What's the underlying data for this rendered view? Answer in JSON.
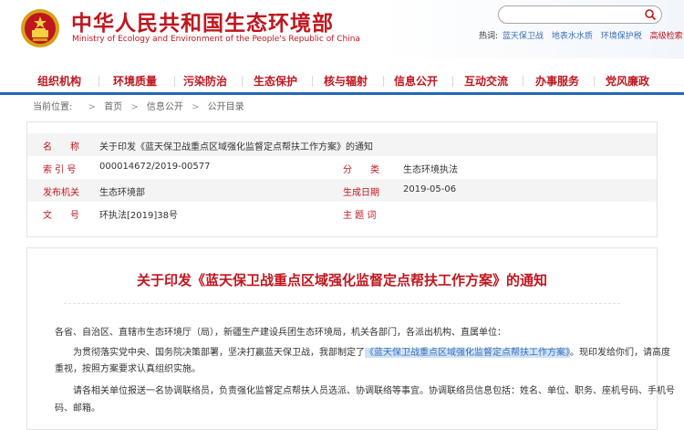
{
  "site": {
    "title_cn": "中华人民共和国生态环境部",
    "title_en": "Ministry of Ecology and Environment of the People's Republic of China",
    "brand_color": "#c0161e",
    "accent_color": "#2767b5"
  },
  "search": {
    "value": "",
    "placeholder": ""
  },
  "hot_search": {
    "label": "热词:",
    "terms": [
      "蓝天保卫战",
      "地表水水质",
      "环境保护税"
    ],
    "advanced": "高级检索"
  },
  "nav": {
    "items": [
      "组织机构",
      "环境质量",
      "污染防治",
      "生态保护",
      "核与辐射",
      "信息公开",
      "互动交流",
      "办事服务",
      "党风廉政"
    ]
  },
  "breadcrumb": {
    "label": "当前位置:",
    "items": [
      "首页",
      "信息公开",
      "公开目录"
    ]
  },
  "meta": {
    "name_label": "名　　称",
    "name_value": "关于印发《蓝天保卫战重点区域强化监督定点帮扶工作方案》的通知",
    "index_label": "索 引 号",
    "index_value": "000014672/2019-00577",
    "category_label": "分　　类",
    "category_value": "生态环境执法",
    "issuer_label": "发布机关",
    "issuer_value": "生态环境部",
    "date_label": "生成日期",
    "date_value": "2019-05-06",
    "docno_label": "文　　号",
    "docno_value": "环执法[2019]38号",
    "keywords_label": "主 题 词",
    "keywords_value": ""
  },
  "article": {
    "title": "关于印发《蓝天保卫战重点区域强化监督定点帮扶工作方案》的通知",
    "p1": "各省、自治区、直辖市生态环境厅（局），新疆生产建设兵团生态环境局，机关各部门，各派出机构、直属单位：",
    "p2_pre": "为贯彻落实党中央、国务院决策部署，坚决打赢蓝天保卫战，我部制定了",
    "p2_link": "《蓝天保卫战重点区域强化监督定点帮扶工作方案》",
    "p2_post": "。现印发给你们，请高度",
    "p3": "重视，按照方案要求认真组织实施。",
    "p4": "请各相关单位报送一名协调联络员，负责强化监督定点帮扶人员选派、协调联络等事宜。协调联络员信息包括：姓名、单位、职务、座机号码、手机号",
    "p5": "码、邮箱。"
  }
}
